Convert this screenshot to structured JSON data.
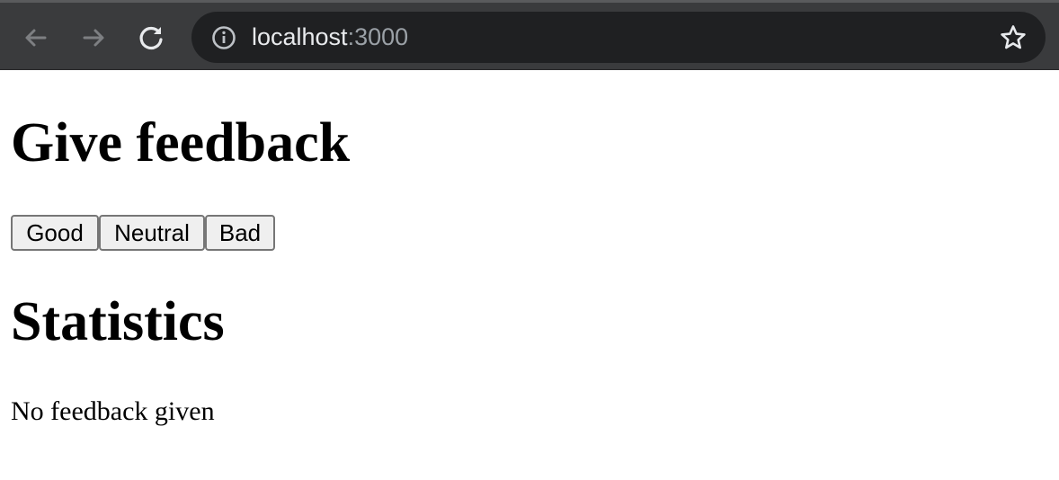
{
  "browser": {
    "url_host": "localhost",
    "url_port": ":3000",
    "icons": {
      "back": "back-arrow-icon",
      "forward": "forward-arrow-icon",
      "reload": "reload-icon",
      "info": "info-icon",
      "bookmark": "star-icon"
    },
    "colors": {
      "toolbar": "#3a3b3d",
      "omnibox": "#1f2022",
      "url_text": "#e8eaed",
      "url_port": "#9aa0a6"
    }
  },
  "page": {
    "title": "Give feedback",
    "buttons": {
      "good": "Good",
      "neutral": "Neutral",
      "bad": "Bad"
    },
    "statistics_title": "Statistics",
    "statistics_text": "No feedback given"
  }
}
